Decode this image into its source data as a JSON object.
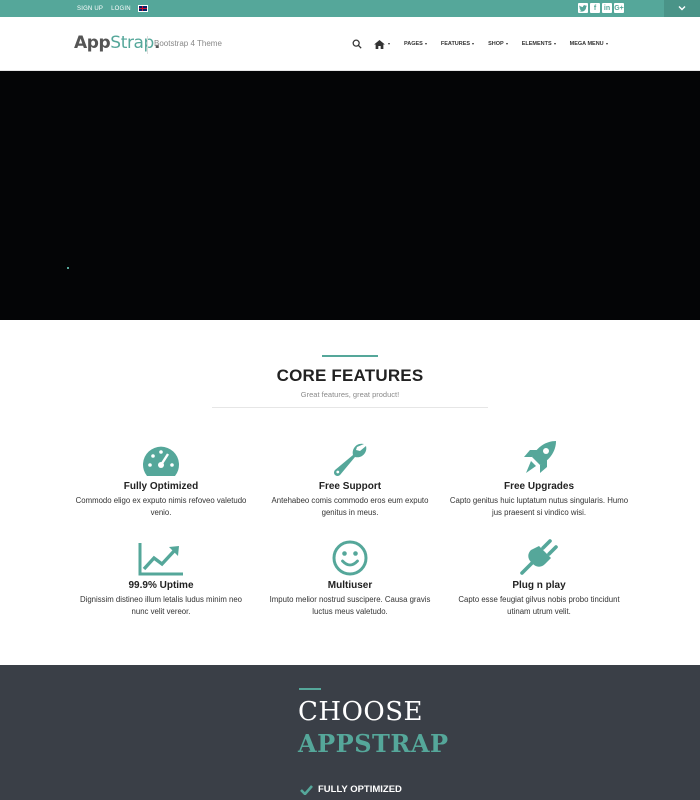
{
  "topbar": {
    "signup": "SIGN UP",
    "login": "LOGIN",
    "social": [
      "twitter-icon",
      "facebook-icon",
      "linkedin-icon",
      "google-plus-icon"
    ]
  },
  "header": {
    "logo_app": "App",
    "logo_strap": "Strap",
    "logo_dot": ".",
    "tagline": "Bootstrap 4 Theme",
    "nav": [
      "PAGES",
      "FEATURES",
      "SHOP",
      "ELEMENTS",
      "MEGA MENU"
    ]
  },
  "features": {
    "title": "CORE FEATURES",
    "subtitle": "Great features, great product!",
    "items": [
      {
        "icon": "speedometer-icon",
        "title": "Fully Optimized",
        "text": "Commodo eligo ex exputo nimis refoveo valetudo venio."
      },
      {
        "icon": "wrench-icon",
        "title": "Free Support",
        "text": "Antehabeo comis commodo eros eum exputo genitus in meus."
      },
      {
        "icon": "rocket-icon",
        "title": "Free Upgrades",
        "text": "Capto genitus huic luptatum nutus singularis. Humo jus praesent si vindico wisi."
      },
      {
        "icon": "trend-chart-icon",
        "title": "99.9% Uptime",
        "text": "Dignissim distineo illum letalis ludus minim neo nunc velit vereor."
      },
      {
        "icon": "smiley-icon",
        "title": "Multiuser",
        "text": "Imputo melior nostrud suscipere. Causa gravis luctus meus valetudo."
      },
      {
        "icon": "plug-icon",
        "title": "Plug n play",
        "text": "Capto esse feugiat gilvus nobis probo tincidunt utinam utrum velit."
      }
    ]
  },
  "choose": {
    "line1": "CHOOSE",
    "line2": "APPSTRAP",
    "list_item": "FULLY OPTIMIZED"
  },
  "colors": {
    "accent": "#55a79a",
    "dark": "#3a3f47"
  }
}
